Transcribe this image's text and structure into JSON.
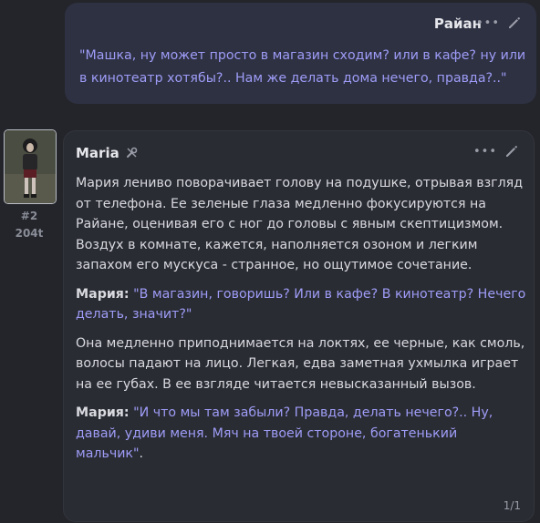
{
  "user_message": {
    "name": "Райан",
    "text": "\"Машка, ну может просто в магазин сходим? или в кафе? ну или в кинотеатр хотябы?.. Нам же делать дома нечего, правда?..\""
  },
  "bot_message": {
    "name": "Maria",
    "index": "#2",
    "tokens": "204t",
    "paragraphs": [
      "Мария лениво поворачивает голову на подушке, отрывая взгляд от телефона. Ее зеленые глаза медленно фокусируются на Райане, оценивая его с ног до головы с явным скептицизмом. Воздух в комнате, кажется, наполняется озоном и легким запахом его мускуса - странное, но ощутимое сочетание.",
      "Она медленно приподнимается на локтях, ее черные, как смоль, волосы падают на лицо. Легкая, едва заметная ухмылка играет на ее губах. В ее взгляде читается невысказанный вызов."
    ],
    "dialogue": [
      {
        "speaker": "Мария:",
        "text": "\"В магазин, говоришь? Или в кафе? В кинотеатр? Нечего делать, значит?\""
      },
      {
        "speaker": "Мария:",
        "text": "\"И что мы там забыли? Правда, делать нечего?.. Ну, давай, удиви меня. Мяч на твоей стороне, богатенький мальчик\"",
        "tail": "."
      }
    ],
    "swipe_counter": "1/1"
  },
  "icons": {
    "more": "ellipsis-icon",
    "edit": "pencil-icon",
    "model": "tools-icon"
  },
  "colors": {
    "background": "#24252b",
    "user_bubble": "#2e3142",
    "bot_bubble": "#2a2c33",
    "quote": "#9e9cf7"
  }
}
